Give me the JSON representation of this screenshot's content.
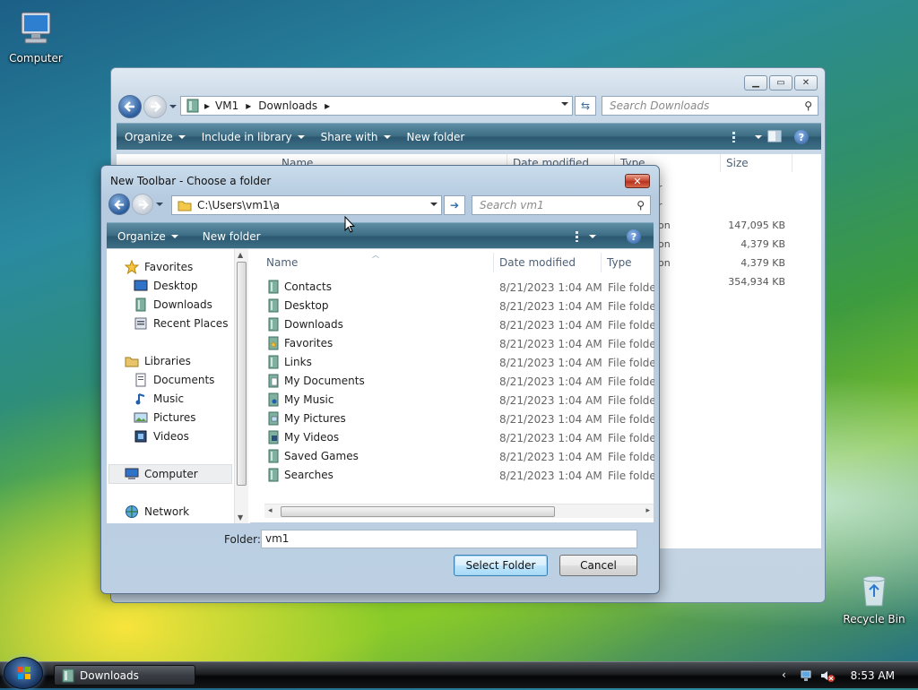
{
  "desktop": {
    "icons": [
      {
        "label": "Computer"
      },
      {
        "label": "Recycle Bin"
      }
    ]
  },
  "explorer": {
    "breadcrumb": [
      "VM1",
      "Downloads"
    ],
    "search_placeholder": "Search Downloads",
    "commands": {
      "organize": "Organize",
      "include_in_library": "Include in library",
      "share_with": "Share with",
      "new_folder": "New folder"
    },
    "columns": {
      "name": "Name",
      "date_modified": "Date modified",
      "type": "Type",
      "size": "Size"
    },
    "partial_rows": [
      {
        "type_tail": "r",
        "size": ""
      },
      {
        "type_tail": "r",
        "size": ""
      },
      {
        "type_tail": "on",
        "size": "147,095 KB"
      },
      {
        "type_tail": "on",
        "size": "4,379 KB"
      },
      {
        "type_tail": "on",
        "size": "4,379 KB"
      },
      {
        "type_tail": "",
        "size": "354,934 KB"
      }
    ]
  },
  "dialog": {
    "title": "New Toolbar - Choose a folder",
    "address": "C:\\Users\\vm1\\a",
    "search_placeholder": "Search vm1",
    "commands": {
      "organize": "Organize",
      "new_folder": "New folder"
    },
    "nav": {
      "favorites": {
        "label": "Favorites",
        "items": [
          "Desktop",
          "Downloads",
          "Recent Places"
        ]
      },
      "libraries": {
        "label": "Libraries",
        "items": [
          "Documents",
          "Music",
          "Pictures",
          "Videos"
        ]
      },
      "computer": "Computer",
      "network": "Network"
    },
    "columns": {
      "name": "Name",
      "date_modified": "Date modified",
      "type": "Type"
    },
    "rows": [
      {
        "name": "Contacts",
        "date": "8/21/2023 1:04 AM",
        "type": "File folder"
      },
      {
        "name": "Desktop",
        "date": "8/21/2023 1:04 AM",
        "type": "File folder"
      },
      {
        "name": "Downloads",
        "date": "8/21/2023 1:04 AM",
        "type": "File folder"
      },
      {
        "name": "Favorites",
        "date": "8/21/2023 1:04 AM",
        "type": "File folder"
      },
      {
        "name": "Links",
        "date": "8/21/2023 1:04 AM",
        "type": "File folder"
      },
      {
        "name": "My Documents",
        "date": "8/21/2023 1:04 AM",
        "type": "File folder"
      },
      {
        "name": "My Music",
        "date": "8/21/2023 1:04 AM",
        "type": "File folder"
      },
      {
        "name": "My Pictures",
        "date": "8/21/2023 1:04 AM",
        "type": "File folder"
      },
      {
        "name": "My Videos",
        "date": "8/21/2023 1:04 AM",
        "type": "File folder"
      },
      {
        "name": "Saved Games",
        "date": "8/21/2023 1:04 AM",
        "type": "File folder"
      },
      {
        "name": "Searches",
        "date": "8/21/2023 1:04 AM",
        "type": "File folder"
      }
    ],
    "folder_label": "Folder:",
    "folder_value": "vm1",
    "select_button": "Select Folder",
    "cancel_button": "Cancel"
  },
  "taskbar": {
    "task_label": "Downloads",
    "time": "8:53 AM"
  }
}
